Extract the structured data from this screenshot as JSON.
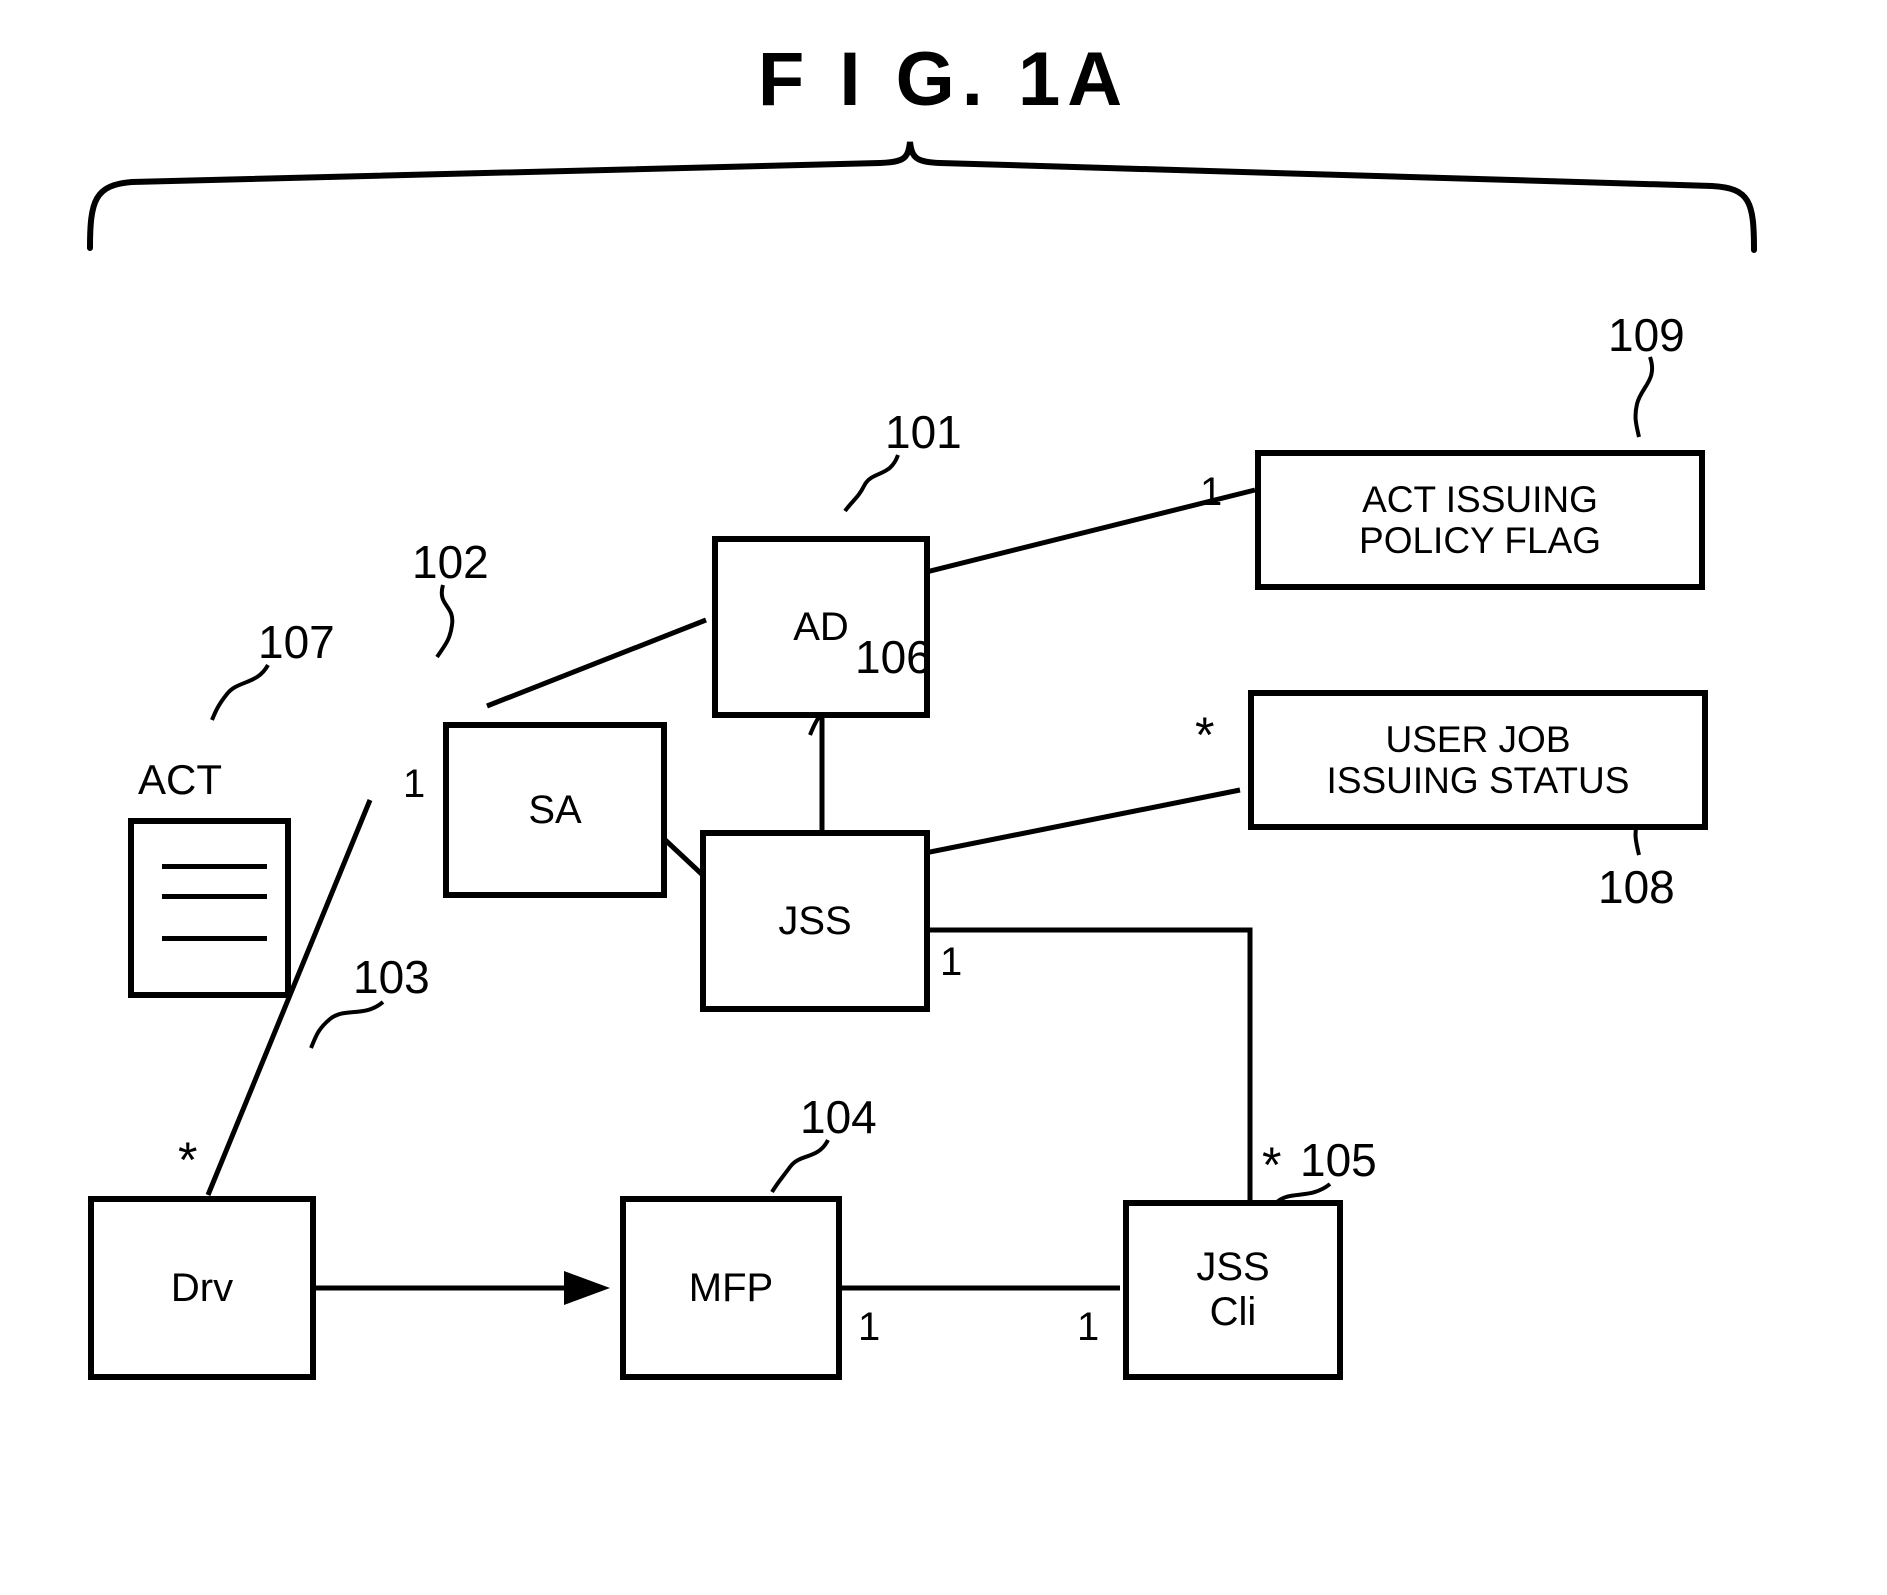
{
  "figure": {
    "title": "F I G.  1A",
    "type": "uml-class-diagram"
  },
  "nodes": {
    "ad": {
      "label": "AD",
      "ref": "101"
    },
    "sa": {
      "label": "SA",
      "ref": "102"
    },
    "drv": {
      "label": "Drv",
      "ref": "103"
    },
    "mfp": {
      "label": "MFP",
      "ref": "104"
    },
    "jss_cli": {
      "label_line1": "JSS",
      "label_line2": "Cli",
      "ref": "105"
    },
    "jss": {
      "label": "JSS",
      "ref": "106"
    },
    "act": {
      "label": "ACT",
      "ref": "107"
    },
    "user_job_issuing_status": {
      "label_line1": "USER JOB",
      "label_line2": "ISSUING STATUS",
      "ref": "108"
    },
    "act_issuing_policy_flag": {
      "label_line1": "ACT ISSUING",
      "label_line2": "POLICY FLAG",
      "ref": "109"
    }
  },
  "multiplicities": {
    "act_flag_to_ad": "1",
    "sa_to_drv_left": "1",
    "drv_star": "*",
    "user_job_status_star": "*",
    "jss_from_jss_cli": "1",
    "mfp_to_jss_cli": "1",
    "jss_cli_to_mfp": "1",
    "jss_cli_star": "*"
  },
  "icons": {
    "document": "document-icon",
    "composition_diamond": "filled-diamond-icon",
    "arrow": "arrowhead-icon",
    "brace": "curly-brace-icon"
  },
  "colors": {
    "stroke": "#000000",
    "background": "#ffffff"
  }
}
